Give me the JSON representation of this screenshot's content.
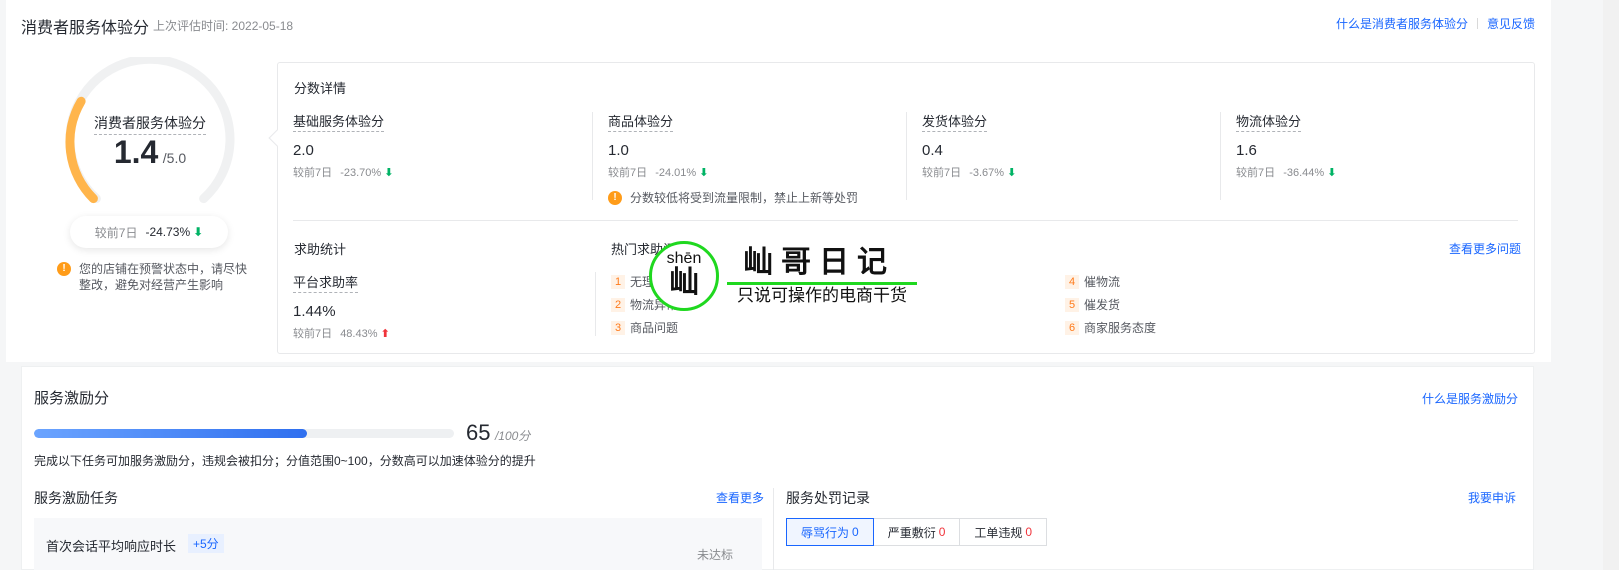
{
  "header": {
    "title": "消费者服务体验分",
    "last_eval": "上次评估时间: 2022-05-18",
    "link_what": "什么是消费者服务体验分",
    "link_feedback": "意见反馈"
  },
  "gauge": {
    "label": "消费者服务体验分",
    "score": "1.4",
    "max": "/5.0",
    "fraction": 0.28,
    "compare_label": "较前7日",
    "compare_value": "-24.73%",
    "warning": "您的店铺在预警状态中，请尽快整改，避免对经营产生影响"
  },
  "details": {
    "title": "分数详情",
    "items": [
      {
        "label": "基础服务体验分",
        "value": "2.0",
        "compare_label": "较前7日",
        "compare_value": "-23.70%",
        "note": ""
      },
      {
        "label": "商品体验分",
        "value": "1.0",
        "compare_label": "较前7日",
        "compare_value": "-24.01%",
        "note": "分数较低将受到流量限制，禁止上新等处罚"
      },
      {
        "label": "发货体验分",
        "value": "0.4",
        "compare_label": "较前7日",
        "compare_value": "-3.67%",
        "note": ""
      },
      {
        "label": "物流体验分",
        "value": "1.6",
        "compare_label": "较前7日",
        "compare_value": "-36.44%",
        "note": ""
      }
    ]
  },
  "help": {
    "title": "求助统计",
    "rate_label": "平台求助率",
    "rate_value": "1.44%",
    "compare_label": "较前7日",
    "compare_value": "48.43%",
    "hot_title": "热门求助问题",
    "more_link": "查看更多问题",
    "hot_items": [
      {
        "rank": "1",
        "text": "无理由"
      },
      {
        "rank": "2",
        "text": "物流异常"
      },
      {
        "rank": "3",
        "text": "商品问题"
      },
      {
        "rank": "4",
        "text": "催物流"
      },
      {
        "rank": "5",
        "text": "催发货"
      },
      {
        "rank": "6",
        "text": "商家服务态度"
      }
    ]
  },
  "watermark": {
    "pinyin": "shēn",
    "char": "屾",
    "title": "屾哥日记",
    "subtitle": "只说可操作的电商干货"
  },
  "incentive": {
    "title": "服务激励分",
    "link_what": "什么是服务激励分",
    "score": "65",
    "max": "/100分",
    "progress": 0.65,
    "desc": "完成以下任务可加服务激励分，违规会被扣分；分值范围0~100，分数高可以加速体验分的提升",
    "tasks_title": "服务激励任务",
    "tasks_more": "查看更多",
    "task_first": "首次会话平均响应时长",
    "task_first_badge": "+5分",
    "task_first_status": "未达标",
    "penalty_title": "服务处罚记录",
    "penalty_link": "我要申诉",
    "penalty_tabs": [
      {
        "label": "辱骂行为",
        "count": "0"
      },
      {
        "label": "严重敷衍",
        "count": "0"
      },
      {
        "label": "工单违规",
        "count": "0"
      }
    ]
  }
}
